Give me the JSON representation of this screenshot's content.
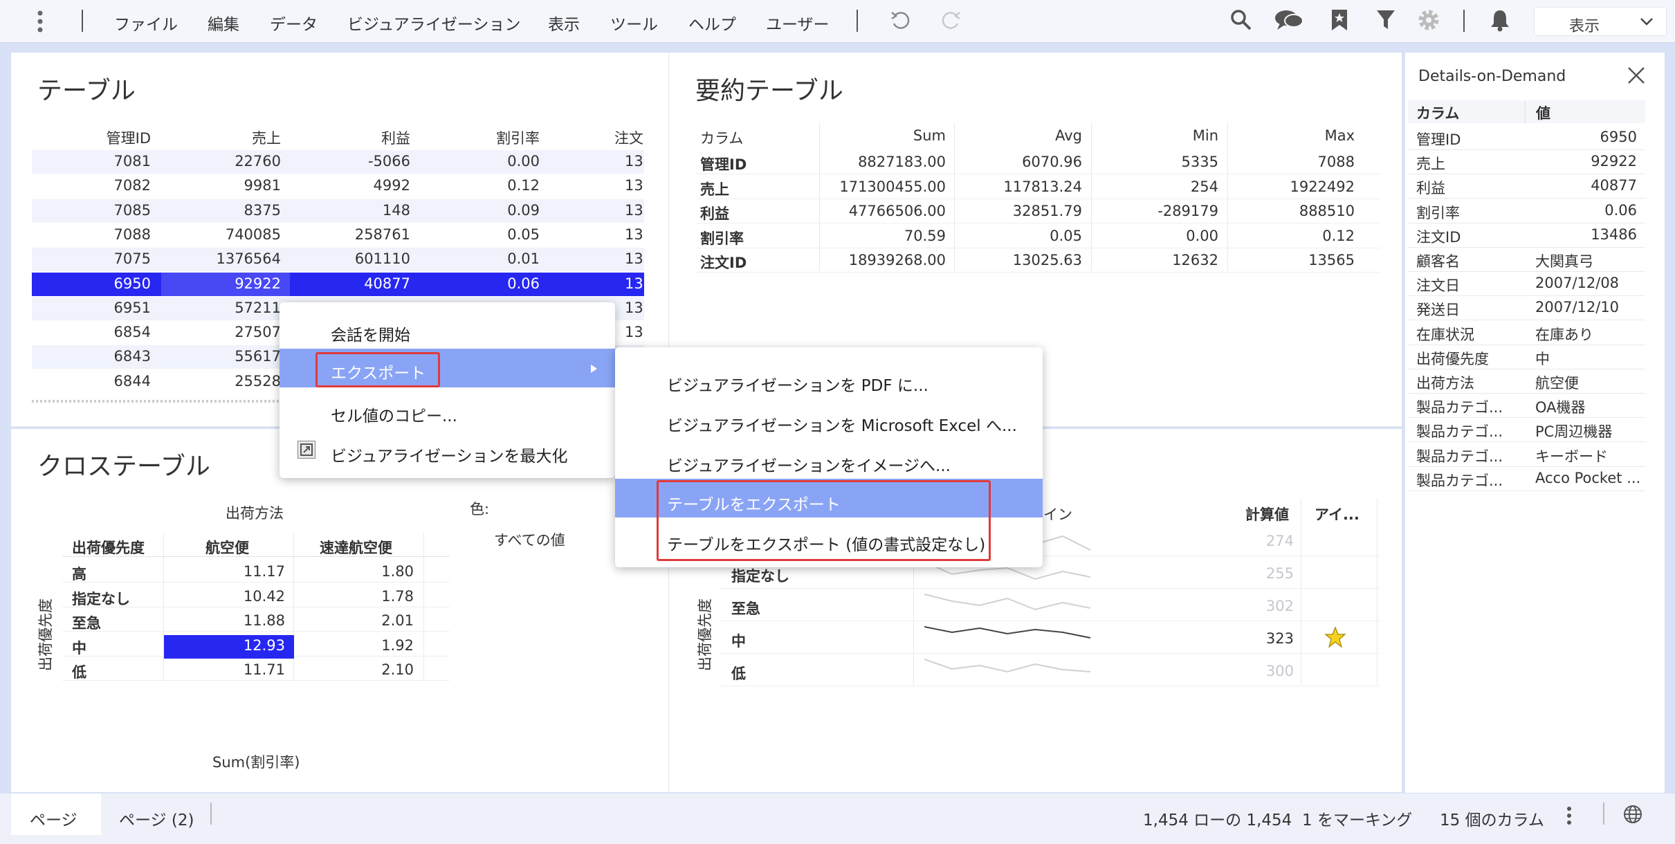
{
  "menubar": {
    "items": [
      "ファイル",
      "編集",
      "データ",
      "ビジュアライゼーション",
      "表示",
      "ツール",
      "ヘルプ",
      "ユーザー"
    ],
    "view_select": "表示"
  },
  "table": {
    "title": "テーブル",
    "columns": [
      "管理ID",
      "売上",
      "利益",
      "割引率",
      "注文"
    ],
    "rows": [
      [
        "7081",
        "22760",
        "-5066",
        "0.00",
        "13"
      ],
      [
        "7082",
        "9981",
        "4992",
        "0.12",
        "13"
      ],
      [
        "7085",
        "8375",
        "148",
        "0.09",
        "13"
      ],
      [
        "7088",
        "740085",
        "258761",
        "0.05",
        "13"
      ],
      [
        "7075",
        "1376564",
        "601110",
        "0.01",
        "13"
      ],
      [
        "6950",
        "92922",
        "40877",
        "0.06",
        "13"
      ],
      [
        "6951",
        "57211",
        "",
        "",
        "13"
      ],
      [
        "6854",
        "27507",
        "",
        "",
        "13"
      ],
      [
        "6843",
        "55617",
        "",
        "",
        ""
      ],
      [
        "6844",
        "25528",
        "",
        "",
        ""
      ]
    ]
  },
  "summary": {
    "title": "要約テーブル",
    "columns": [
      "カラム",
      "Sum",
      "Avg",
      "Min",
      "Max"
    ],
    "rows": [
      [
        "管理ID",
        "8827183.00",
        "6070.96",
        "5335",
        "7088"
      ],
      [
        "売上",
        "171300455.00",
        "117813.24",
        "254",
        "1922492"
      ],
      [
        "利益",
        "47766506.00",
        "32851.79",
        "-289179",
        "888510"
      ],
      [
        "割引率",
        "70.59",
        "0.05",
        "0.00",
        "0.12"
      ],
      [
        "注文ID",
        "18939268.00",
        "13025.63",
        "12632",
        "13565"
      ]
    ]
  },
  "cross": {
    "title": "クロステーブル",
    "col_group": "出荷方法",
    "row_header": "出荷優先度",
    "columns": [
      "航空便",
      "速達航空便"
    ],
    "row_axis": "出荷優先度",
    "color_label": "色:",
    "color_value": "すべての値",
    "measure": "Sum(割引率)",
    "rows": [
      [
        "高",
        "11.17",
        "1.80"
      ],
      [
        "指定なし",
        "10.42",
        "1.78"
      ],
      [
        "至急",
        "11.88",
        "2.01"
      ],
      [
        "中",
        "12.93",
        "1.92"
      ],
      [
        "低",
        "11.71",
        "2.10"
      ]
    ]
  },
  "graphical": {
    "col_line": "イン",
    "col_calc": "計算値",
    "col_icon": "アイ...",
    "row_axis": "出荷優先度",
    "rows": [
      {
        "label": "",
        "value": "274",
        "highlight": false
      },
      {
        "label": "指定なし",
        "value": "255",
        "highlight": false
      },
      {
        "label": "至急",
        "value": "302",
        "highlight": false
      },
      {
        "label": "中",
        "value": "323",
        "highlight": true,
        "icon": "star-icon"
      },
      {
        "label": "低",
        "value": "300",
        "highlight": false
      }
    ]
  },
  "context_menu": {
    "items": [
      "会話を開始",
      "エクスポート",
      "セル値のコピー...",
      "ビジュアライゼーションを最大化"
    ]
  },
  "export_menu": {
    "items": [
      "ビジュアライゼーションを PDF に...",
      "ビジュアライゼーションを Microsoft Excel へ...",
      "ビジュアライゼーションをイメージへ...",
      "テーブルをエクスポート",
      "テーブルをエクスポート (値の書式設定なし)"
    ]
  },
  "details": {
    "title": "Details-on-Demand",
    "col_name": "カラム",
    "col_value": "値",
    "rows": [
      [
        "管理ID",
        "6950"
      ],
      [
        "売上",
        "92922"
      ],
      [
        "利益",
        "40877"
      ],
      [
        "割引率",
        "0.06"
      ],
      [
        "注文ID",
        "13486"
      ],
      [
        "顧客名",
        "大関真弓"
      ],
      [
        "注文日",
        "2007/12/08"
      ],
      [
        "発送日",
        "2007/12/10"
      ],
      [
        "在庫状況",
        "在庫あり"
      ],
      [
        "出荷優先度",
        "中"
      ],
      [
        "出荷方法",
        "航空便"
      ],
      [
        "製品カテゴ...",
        "OA機器"
      ],
      [
        "製品カテゴ...",
        "PC周辺機器"
      ],
      [
        "製品カテゴ...",
        "キーボード"
      ],
      [
        "製品カテゴ...",
        "Acco Pocket ..."
      ]
    ]
  },
  "statusbar": {
    "tabs": [
      "ページ",
      "ページ (2)"
    ],
    "rows": "1,454 ローの 1,454",
    "marking": "1 をマーキング",
    "columns": "15 個のカラム"
  },
  "colors": {
    "accent": "#2727f2",
    "menu_highlight": "#8aa4f5",
    "red": "#e03a3a",
    "row_alt": "#f0f3fb"
  }
}
